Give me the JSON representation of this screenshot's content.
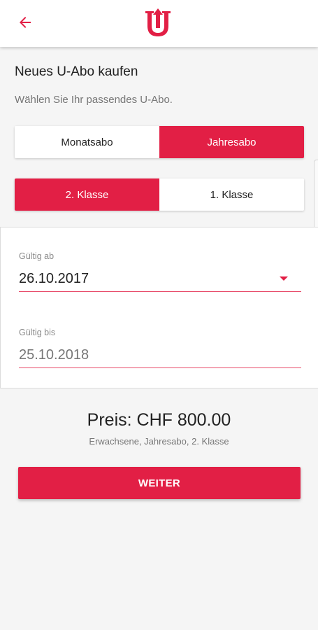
{
  "appbar": {
    "back_icon": "arrow-left-icon",
    "logo_text": "U",
    "accent_color": "#e21f45"
  },
  "page": {
    "title": "Neues U-Abo kaufen",
    "subtitle": "Wählen Sie Ihr passendes U-Abo."
  },
  "subscription_type": {
    "options": [
      {
        "label": "Monatsabo",
        "selected": false
      },
      {
        "label": "Jahresabo",
        "selected": true
      }
    ]
  },
  "travel_class": {
    "options": [
      {
        "label": "2. Klasse",
        "selected": true
      },
      {
        "label": "1. Klasse",
        "selected": false
      }
    ]
  },
  "validity": {
    "from_label": "Gültig ab",
    "from_value": "26.10.2017",
    "from_icon": "dropdown-arrow-icon",
    "to_label": "Gültig bis",
    "to_value": "25.10.2018"
  },
  "summary": {
    "price": "Preis: CHF 800.00",
    "details": "Erwachsene, Jahresabo, 2. Klasse"
  },
  "actions": {
    "continue_label": "WEITER"
  }
}
